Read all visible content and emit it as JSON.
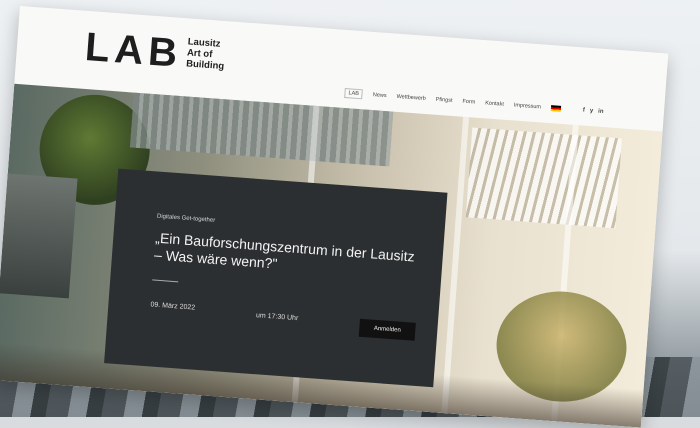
{
  "logo": {
    "mark": "LAB",
    "lines": [
      "Lausitz",
      "Art of",
      "Building"
    ]
  },
  "nav": {
    "items": [
      "LAB",
      "News",
      "Wettbewerb",
      "Pfingst",
      "Form",
      "Kontakt",
      "Impressum"
    ],
    "active_index": 0,
    "social": [
      "f",
      "y",
      "in"
    ]
  },
  "event": {
    "kicker": "Digitales Get-together",
    "title": "„Ein Bauforschungszentrum in der Lausitz – Was wäre wenn?\"",
    "date": "09. März 2022",
    "time": "um 17:30 Uhr",
    "button": "Anmelden"
  }
}
